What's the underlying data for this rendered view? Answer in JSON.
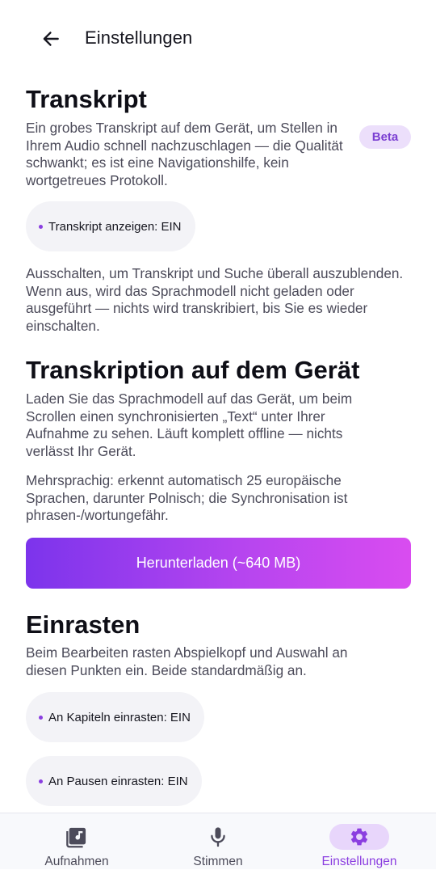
{
  "header": {
    "title": "Einstellungen",
    "back_icon": "arrow-left-icon"
  },
  "transcript": {
    "title": "Transkript",
    "badge": "Beta",
    "description": "Ein grobes Transkript auf dem Gerät, um Stellen in Ihrem Audio schnell nachzuschlagen — die Qualität schwankt; es ist eine Navigationshilfe, kein wortgetreues Protokoll.",
    "toggle_label": "Transkript anzeigen: EIN",
    "toggle_state": "EIN",
    "hint": "Ausschalten, um Transkript und Suche überall auszublenden. Wenn aus, wird das Sprachmodell nicht geladen oder ausgeführt — nichts wird transkribiert, bis Sie es wieder einschalten."
  },
  "on_device": {
    "title": "Transkription auf dem Gerät",
    "description": "Laden Sie das Sprachmodell auf das Gerät, um beim Scrollen einen synchronisierten „Text“ unter Ihrer Aufnahme zu sehen. Läuft komplett offline — nichts verlässt Ihr Gerät.",
    "languages": "Mehrsprachig: erkennt automatisch 25 europäische Sprachen, darunter Polnisch; die Synchronisation ist phrasen-/wortungefähr.",
    "download_label": "Herunterladen (~640 MB)"
  },
  "snapping": {
    "title": "Einrasten",
    "description": "Beim Bearbeiten rasten Abspielkopf und Auswahl an diesen Punkten ein. Beide standardmäßig an.",
    "chapters_label": "An Kapiteln einrasten: EIN",
    "pauses_label": "An Pausen einrasten: EIN"
  },
  "bottom_nav": {
    "items": [
      {
        "label": "Aufnahmen",
        "icon": "music-library-icon",
        "active": false
      },
      {
        "label": "Stimmen",
        "icon": "microphone-icon",
        "active": false
      },
      {
        "label": "Einstellungen",
        "icon": "gear-icon",
        "active": true
      }
    ]
  },
  "colors": {
    "accent": "#8b3ee0",
    "badge_bg": "#ecdffb",
    "chip_bg": "#f3f3f7",
    "gradient_start": "#7c34ec",
    "gradient_end": "#d94cf0"
  }
}
